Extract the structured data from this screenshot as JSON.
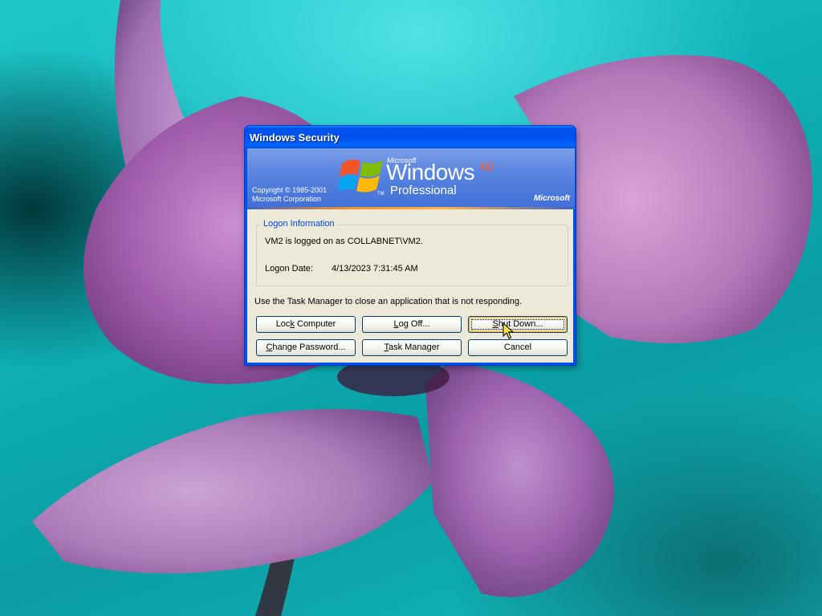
{
  "window": {
    "title": "Windows Security"
  },
  "banner": {
    "brand_small": "Microsoft",
    "product": "Windows",
    "version_suffix": "xp",
    "trademark": "TM",
    "edition": "Professional",
    "copyright_line1": "Copyright © 1985-2001",
    "copyright_line2": "Microsoft Corporation",
    "company": "Microsoft"
  },
  "logon_info": {
    "legend": "Logon Information",
    "message": "VM2 is logged on as COLLABNET\\VM2.",
    "date_label": "Logon Date:",
    "date_value": "4/13/2023 7:31:45 AM"
  },
  "hint": "Use the Task Manager to close an application that is not responding.",
  "buttons": {
    "lock": {
      "label_before": "Loc",
      "accel": "k",
      "label_after": " Computer"
    },
    "logoff": {
      "label_before": "",
      "accel": "L",
      "label_after": "og Off..."
    },
    "shutdown": {
      "label_before": "",
      "accel": "S",
      "label_after": "hut Down..."
    },
    "change_password": {
      "label_before": "",
      "accel": "C",
      "label_after": "hange Password..."
    },
    "task_manager": {
      "label_before": "",
      "accel": "T",
      "label_after": "ask Manager"
    },
    "cancel": {
      "label": "Cancel"
    }
  },
  "focused_button": "shutdown",
  "colors": {
    "titlebar": "#0054e3",
    "dialog_face": "#ece9d8",
    "group_legend": "#0046d5",
    "xp_accent": "#ff5a1f"
  },
  "icons": {
    "logo": "windows-flag-icon",
    "pointer": "mouse-pointer-icon"
  }
}
